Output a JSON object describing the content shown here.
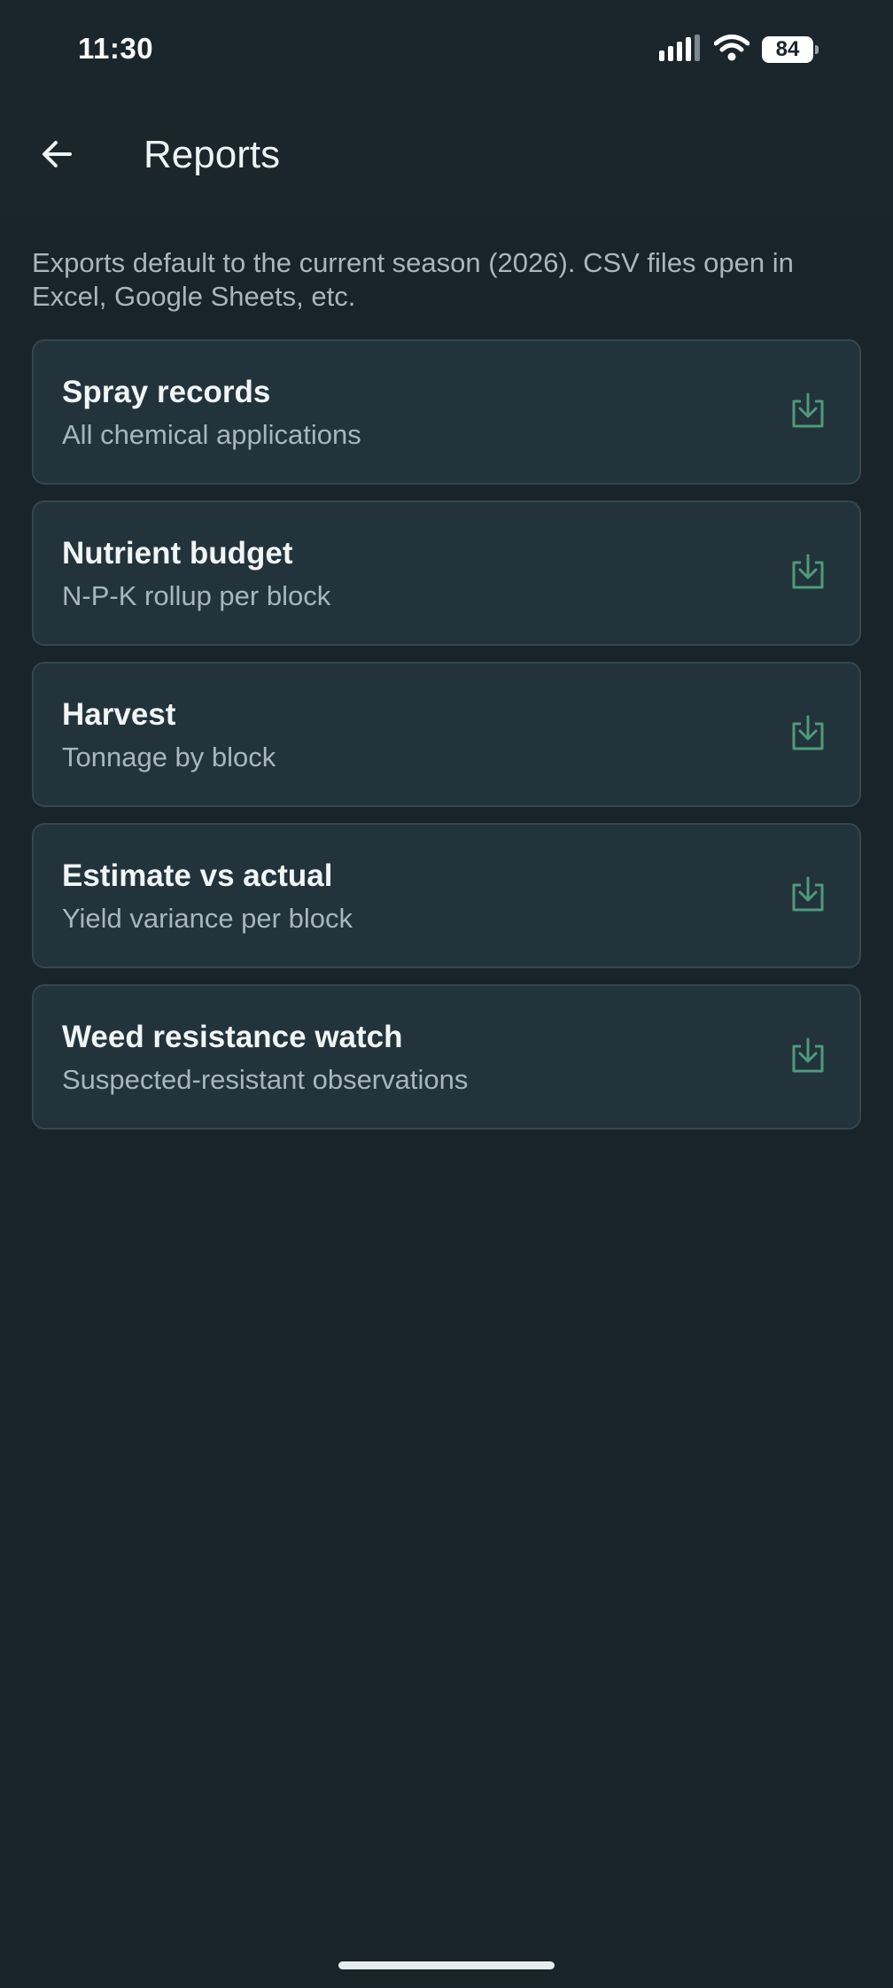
{
  "status": {
    "time": "11:30",
    "battery": "84",
    "icons": [
      "signal-icon",
      "wifi-icon",
      "battery-icon"
    ]
  },
  "header": {
    "title": "Reports",
    "back_icon": "arrow-left-icon"
  },
  "intro": "Exports default to the current season (2026). CSV files open in Excel, Google Sheets, etc.",
  "reports": [
    {
      "title": "Spray records",
      "subtitle": "All chemical applications"
    },
    {
      "title": "Nutrient budget",
      "subtitle": "N-P-K rollup per block"
    },
    {
      "title": "Harvest",
      "subtitle": "Tonnage by block"
    },
    {
      "title": "Estimate vs actual",
      "subtitle": "Yield variance per block"
    },
    {
      "title": "Weed resistance watch",
      "subtitle": "Suspected-resistant observations"
    }
  ],
  "colors": {
    "background": "#18242a",
    "card": "#22333b",
    "card_border": "#34464e",
    "accent_icon": "#4f9a7c",
    "primary_text": "#f1f5f6",
    "secondary_text": "#a9b6bb"
  }
}
